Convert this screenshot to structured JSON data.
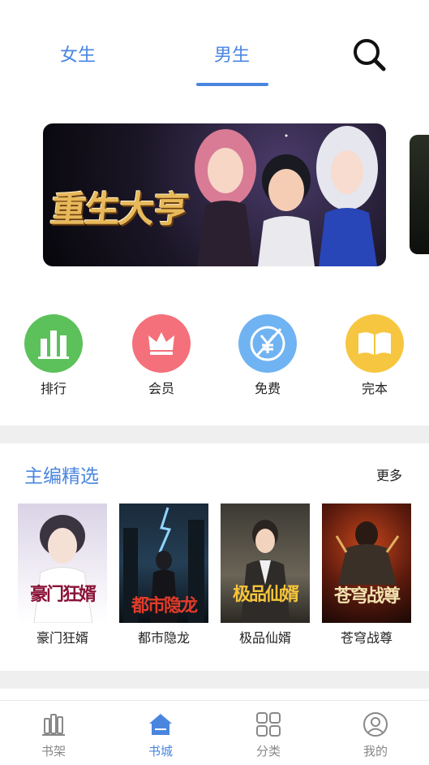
{
  "top_tabs": {
    "female": "女生",
    "male": "男生",
    "active": "男生"
  },
  "search": {
    "icon": "search-icon"
  },
  "banner": {
    "title": "重生大亨"
  },
  "quick_entries": [
    {
      "label": "排行",
      "icon": "ranking-chart-icon",
      "color": "#5cc15a"
    },
    {
      "label": "会员",
      "icon": "crown-icon",
      "color": "#f4707a"
    },
    {
      "label": "免费",
      "icon": "yen-free-icon",
      "color": "#6fb3f2"
    },
    {
      "label": "完本",
      "icon": "open-book-icon",
      "color": "#f7c640"
    }
  ],
  "editor_picks": {
    "title": "主编精选",
    "more": "更多",
    "books": [
      {
        "name": "豪门狂婿",
        "cover_text": "豪门狂婿"
      },
      {
        "name": "都市隐龙",
        "cover_text": "都市隐龙"
      },
      {
        "name": "极品仙婿",
        "cover_text": "极品仙婿"
      },
      {
        "name": "苍穹战尊",
        "cover_text": "苍穹战尊"
      }
    ]
  },
  "bottom_nav": [
    {
      "label": "书架",
      "icon": "bookshelf-icon",
      "active": false
    },
    {
      "label": "书城",
      "icon": "home-icon",
      "active": true
    },
    {
      "label": "分类",
      "icon": "category-grid-icon",
      "active": false
    },
    {
      "label": "我的",
      "icon": "profile-icon",
      "active": false
    }
  ],
  "colors": {
    "accent": "#4a86e0",
    "inactive": "#888888",
    "divider": "#efefef"
  }
}
